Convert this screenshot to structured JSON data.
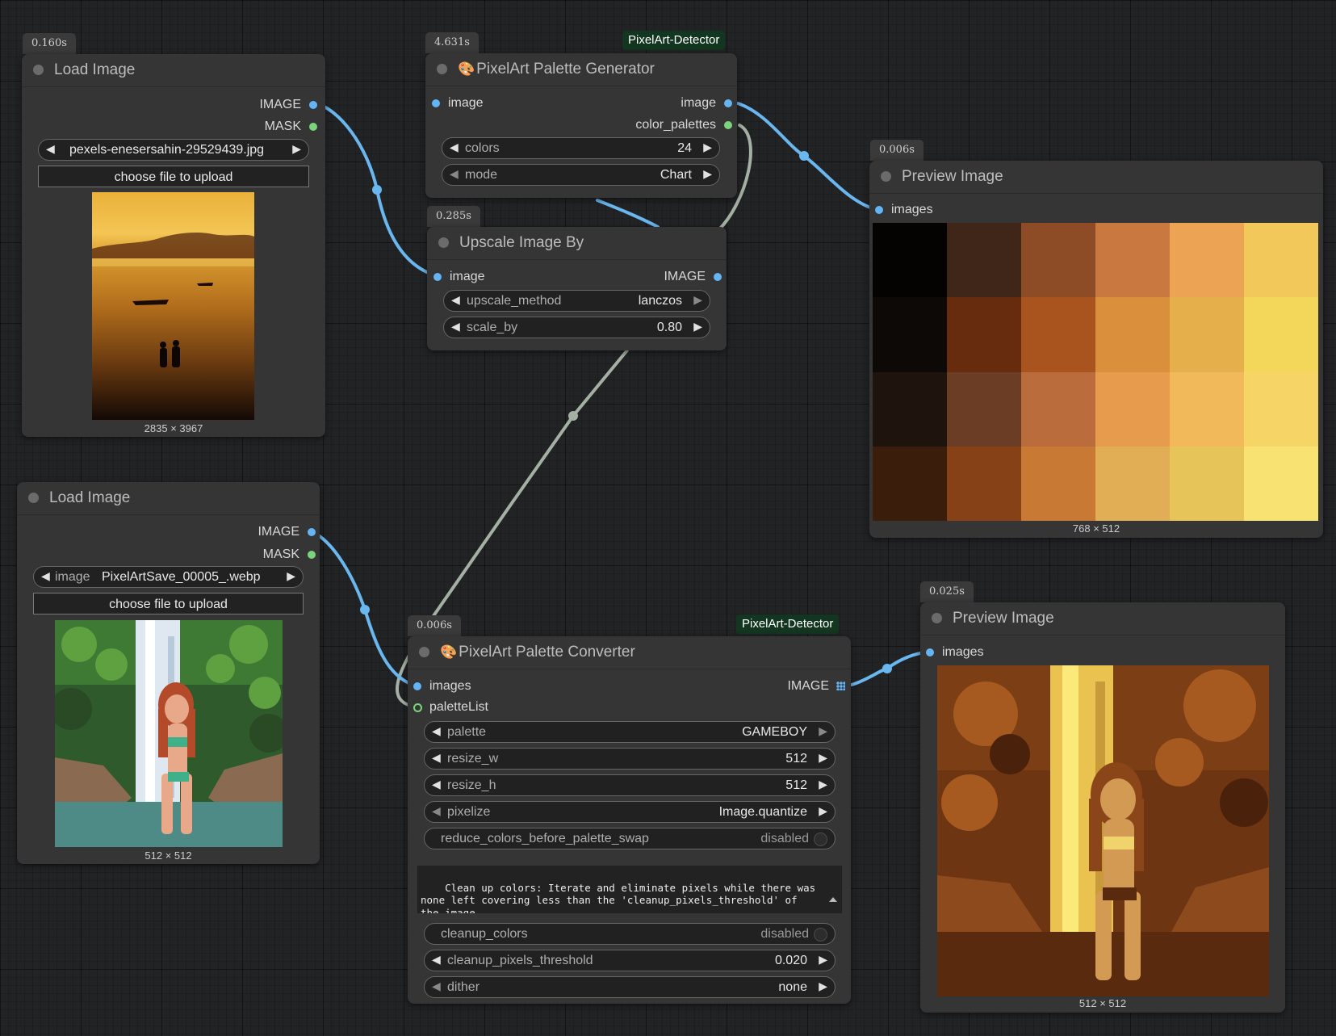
{
  "nodes": {
    "load_image_1": {
      "timing": "0.160s",
      "title": "Load Image",
      "outputs": [
        "IMAGE",
        "MASK"
      ],
      "file_widget": {
        "value": "pexels-enesersahin-29529439.jpg"
      },
      "upload_label": "choose file to upload",
      "caption": "2835 × 3967"
    },
    "palette_generator": {
      "timing": "4.631s",
      "badge": "PixelArt-Detector",
      "emoji": "🎨",
      "title": "PixelArt Palette Generator",
      "inputs": [
        "image"
      ],
      "outputs": [
        "image",
        "color_palettes"
      ],
      "widgets": [
        {
          "label": "colors",
          "value": "24"
        },
        {
          "label": "mode",
          "value": "Chart"
        }
      ]
    },
    "upscale": {
      "timing": "0.285s",
      "title": "Upscale Image By",
      "inputs": [
        "image"
      ],
      "outputs": [
        "IMAGE"
      ],
      "widgets": [
        {
          "label": "upscale_method",
          "value": "lanczos"
        },
        {
          "label": "scale_by",
          "value": "0.80"
        }
      ]
    },
    "preview_1": {
      "timing": "0.006s",
      "title": "Preview Image",
      "inputs": [
        "images"
      ],
      "caption": "768 × 512",
      "palette_colors": [
        [
          "#050302",
          "#3f2618",
          "#8e4c26",
          "#c97940",
          "#eca353",
          "#f3c85b"
        ],
        [
          "#0d0906",
          "#672b0e",
          "#a9541f",
          "#d98f3c",
          "#e5b04b",
          "#f3d75b"
        ],
        [
          "#1e140d",
          "#6a3d24",
          "#bb6c3c",
          "#e79b4d",
          "#f2b95a",
          "#f6d566"
        ],
        [
          "#3a1d0b",
          "#874117",
          "#c87a34",
          "#e2ae55",
          "#e6c45a",
          "#f8e372"
        ]
      ]
    },
    "load_image_2": {
      "title": "Load Image",
      "outputs": [
        "IMAGE",
        "MASK"
      ],
      "file_widget": {
        "label": "image",
        "value": "PixelArtSave_00005_.webp"
      },
      "upload_label": "choose file to upload",
      "caption": "512 × 512"
    },
    "palette_converter": {
      "timing": "0.006s",
      "badge": "PixelArt-Detector",
      "emoji": "🎨",
      "title": "PixelArt Palette Converter",
      "inputs": [
        "images",
        "paletteList"
      ],
      "outputs": [
        "IMAGE"
      ],
      "widgets": [
        {
          "label": "palette",
          "value": "GAMEBOY"
        },
        {
          "label": "resize_w",
          "value": "512"
        },
        {
          "label": "resize_h",
          "value": "512"
        },
        {
          "label": "pixelize",
          "value": "Image.quantize"
        },
        {
          "label": "reduce_colors_before_palette_swap",
          "value": "disabled"
        }
      ],
      "textarea": "Clean up colors: Iterate and eliminate pixels while there was none left covering less than the 'cleanup_pixels_threshold' of the image.\nOptionally, enable the 'reduce_colors' option, which runs before",
      "widgets2": [
        {
          "label": "cleanup_colors",
          "value": "disabled"
        },
        {
          "label": "cleanup_pixels_threshold",
          "value": "0.020"
        },
        {
          "label": "dither",
          "value": "none"
        }
      ]
    },
    "preview_2": {
      "timing": "0.025s",
      "title": "Preview Image",
      "inputs": [
        "images"
      ],
      "caption": "512 × 512"
    }
  },
  "colors": {
    "image_port": "#64b5f6",
    "mask_port": "#7bd37b",
    "image_link": "#6ab6ef",
    "palette_link": "#a4b0a4",
    "badge_bg": "#12361f"
  }
}
